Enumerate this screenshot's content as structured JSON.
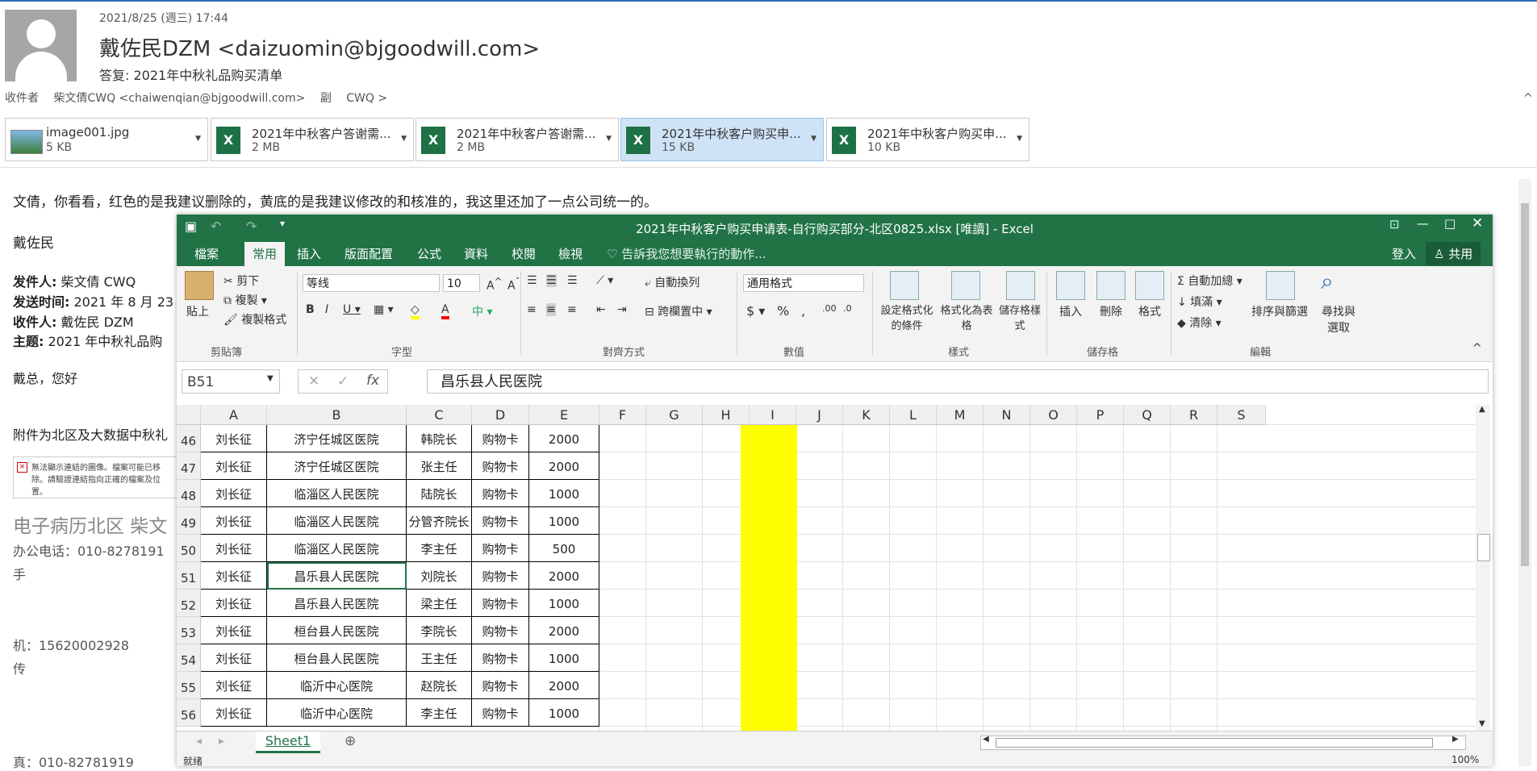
{
  "email": {
    "date": "2021/8/25 (週三) 17:44",
    "from": "戴佐民DZM <daizuomin@bjgoodwill.com>",
    "subject": "答复: 2021年中秋礼品购买清单",
    "to_label": "收件者",
    "to": "柴文倩CWQ <chaiwenqian@bjgoodwill.com>",
    "cc_label": "副",
    "cc": "CWQ >",
    "collapse": "^"
  },
  "attachments": [
    {
      "name": "image001.jpg",
      "size": "5 KB"
    },
    {
      "name": "2021年中秋客户答谢需...",
      "size": "2 MB"
    },
    {
      "name": "2021年中秋客户答谢需...",
      "size": "2 MB"
    },
    {
      "name": "2021年中秋客户购买申...",
      "size": "15 KB"
    },
    {
      "name": "2021年中秋客户购买申...",
      "size": "10 KB"
    }
  ],
  "body": {
    "intro": "文倩，你看看，红色的是我建议删除的，黄底的是我建议修改的和核准的，我这里还加了一点公司统一的。",
    "sign": "戴佐民",
    "q_from_label": "发件人:",
    "q_from": "柴文倩 CWQ",
    "q_time_label": "发送时间:",
    "q_time": "2021 年 8 月 23",
    "q_to_label": "收件人:",
    "q_to": "戴佐民 DZM",
    "q_subj_label": "主题:",
    "q_subj": "2021 年中秋礼品购",
    "greeting": "戴总，您好",
    "attach_line": "附件为北区及大数据中秋礼",
    "broken_img": "無法顯示連結的圖像。檔案可能已移除。請驗證連結指向正確的檔案及位置。",
    "sig_title": "电子病历北区  柴文",
    "sig_phone": "办公电话：010-8278191",
    "sig_hand": "手",
    "sig_mobile": "机：15620002928",
    "sig_fax": "传",
    "sig_fax2": "真：010-82781919"
  },
  "excel": {
    "title": "2021年中秋客户购买申请表-自行购买部分-北区0825.xlsx  [唯讀]  -  Excel",
    "menu": [
      "檔案",
      "常用",
      "插入",
      "版面配置",
      "公式",
      "資料",
      "校閱",
      "檢視"
    ],
    "tellme": "告訴我您想要執行的動作...",
    "signin": "登入",
    "share": "共用",
    "ribbon": {
      "paste": "貼上",
      "cut": "剪下",
      "copy": "複製",
      "format_painter": "複製格式",
      "clipboard": "剪貼簿",
      "font_name": "等线",
      "font_size": "10",
      "font": "字型",
      "wrap": "自動換列",
      "merge": "跨欄置中",
      "alignment": "對齊方式",
      "number_format": "通用格式",
      "number": "數值",
      "cond_format": "設定格式化的條件",
      "as_table": "格式化為表格",
      "cell_styles": "儲存格樣式",
      "styles": "樣式",
      "insert": "插入",
      "delete": "刪除",
      "format": "格式",
      "cells": "儲存格",
      "autosum": "自動加總",
      "fill": "填滿",
      "clear": "清除",
      "sort": "排序與篩選",
      "find": "尋找與選取",
      "editing": "編輯"
    },
    "namebox": "B51",
    "formula": "昌乐县人民医院",
    "columns": [
      "A",
      "B",
      "C",
      "D",
      "E",
      "F",
      "G",
      "H",
      "I",
      "J",
      "K",
      "L",
      "M",
      "N",
      "O",
      "P",
      "Q",
      "R",
      "S"
    ],
    "rows": [
      {
        "num": "46",
        "a": "刘长征",
        "b": "济宁任城区医院",
        "c": "韩院长",
        "d": "购物卡",
        "e": "2000"
      },
      {
        "num": "47",
        "a": "刘长征",
        "b": "济宁任城区医院",
        "c": "张主任",
        "d": "购物卡",
        "e": "2000"
      },
      {
        "num": "48",
        "a": "刘长征",
        "b": "临淄区人民医院",
        "c": "陆院长",
        "d": "购物卡",
        "e": "1000"
      },
      {
        "num": "49",
        "a": "刘长征",
        "b": "临淄区人民医院",
        "c": "分管齐院长",
        "d": "购物卡",
        "e": "1000"
      },
      {
        "num": "50",
        "a": "刘长征",
        "b": "临淄区人民医院",
        "c": "李主任",
        "d": "购物卡",
        "e": "500"
      },
      {
        "num": "51",
        "a": "刘长征",
        "b": "昌乐县人民医院",
        "c": "刘院长",
        "d": "购物卡",
        "e": "2000"
      },
      {
        "num": "52",
        "a": "刘长征",
        "b": "昌乐县人民医院",
        "c": "梁主任",
        "d": "购物卡",
        "e": "1000"
      },
      {
        "num": "53",
        "a": "刘长征",
        "b": "桓台县人民医院",
        "c": "李院长",
        "d": "购物卡",
        "e": "2000"
      },
      {
        "num": "54",
        "a": "刘长征",
        "b": "桓台县人民医院",
        "c": "王主任",
        "d": "购物卡",
        "e": "1000"
      },
      {
        "num": "55",
        "a": "刘长征",
        "b": "临沂中心医院",
        "c": "赵院长",
        "d": "购物卡",
        "e": "2000"
      },
      {
        "num": "56",
        "a": "刘长征",
        "b": "临沂中心医院",
        "c": "李主任",
        "d": "购物卡",
        "e": "1000"
      }
    ],
    "sheet": "Sheet1",
    "status": "就绪",
    "zoom": "100%"
  },
  "colors": {
    "excel_green": "#217346",
    "highlight": "#ffff00",
    "selected_attachment": "#cfe3f7"
  }
}
